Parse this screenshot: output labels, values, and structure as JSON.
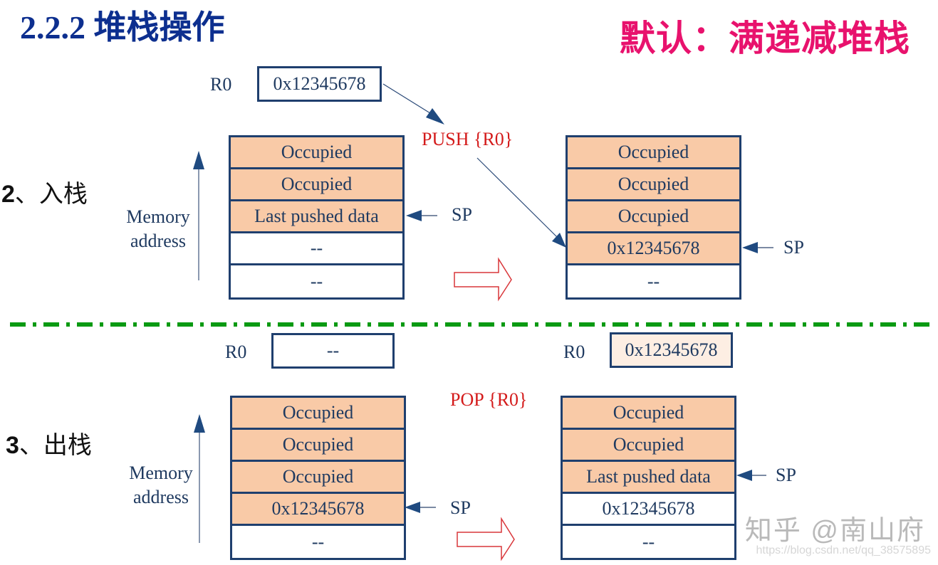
{
  "header": {
    "title": "2.2.2 堆栈操作",
    "subtitle": "默认：满递减堆栈"
  },
  "colors": {
    "title": "#0d2f8f",
    "subtitle": "#e8126d",
    "occupied_fill": "#f9caa7",
    "outline": "#1f3f6e",
    "operation_text": "#d41b1b",
    "separator": "#0a9a12"
  },
  "push_section": {
    "label_num": "2",
    "label_text": "、入栈",
    "operation": "PUSH {R0}",
    "register": {
      "name": "R0",
      "value": "0x12345678"
    },
    "memory_label": [
      "Memory",
      "address"
    ],
    "before": {
      "cells": [
        {
          "text": "Occupied",
          "state": "occupied"
        },
        {
          "text": "Occupied",
          "state": "occupied"
        },
        {
          "text": "Last pushed data",
          "state": "occupied"
        },
        {
          "text": "--",
          "state": "empty"
        },
        {
          "text": "--",
          "state": "empty"
        }
      ],
      "sp_label": "SP",
      "sp_index": 2
    },
    "after": {
      "cells": [
        {
          "text": "Occupied",
          "state": "occupied"
        },
        {
          "text": "Occupied",
          "state": "occupied"
        },
        {
          "text": "Occupied",
          "state": "occupied"
        },
        {
          "text": "0x12345678",
          "state": "occupied"
        },
        {
          "text": "--",
          "state": "empty"
        }
      ],
      "sp_label": "SP",
      "sp_index": 3
    }
  },
  "pop_section": {
    "label_num": "3",
    "label_text": "、出栈",
    "operation": "POP {R0}",
    "register_before": {
      "name": "R0",
      "value": "--"
    },
    "register_after": {
      "name": "R0",
      "value": "0x12345678"
    },
    "memory_label": [
      "Memory",
      "address"
    ],
    "before": {
      "cells": [
        {
          "text": "Occupied",
          "state": "occupied"
        },
        {
          "text": "Occupied",
          "state": "occupied"
        },
        {
          "text": "Occupied",
          "state": "occupied"
        },
        {
          "text": "0x12345678",
          "state": "occupied"
        },
        {
          "text": "--",
          "state": "empty"
        }
      ],
      "sp_label": "SP",
      "sp_index": 3
    },
    "after": {
      "cells": [
        {
          "text": "Occupied",
          "state": "occupied"
        },
        {
          "text": "Occupied",
          "state": "occupied"
        },
        {
          "text": "Last pushed data",
          "state": "occupied"
        },
        {
          "text": "0x12345678",
          "state": "empty"
        },
        {
          "text": "--",
          "state": "empty"
        }
      ],
      "sp_label": "SP",
      "sp_index": 2
    }
  },
  "watermark": {
    "text": "知乎 @南山府",
    "url": "https://blog.csdn.net/qq_38575895"
  }
}
